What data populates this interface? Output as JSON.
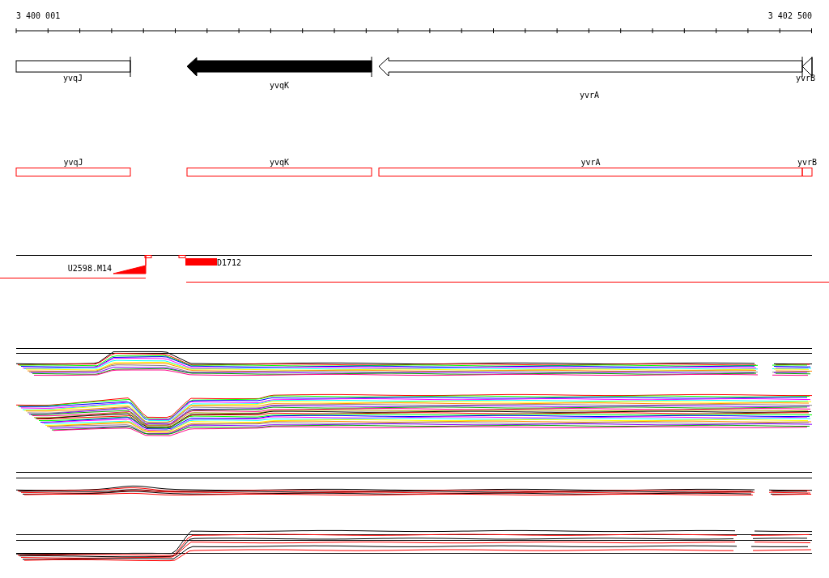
{
  "ruler": {
    "start_label": "3 400 001",
    "end_label": "3 402 500"
  },
  "genes": [
    {
      "name": "yvqJ",
      "kind": "box",
      "filled": false
    },
    {
      "name": "yvqK",
      "kind": "arrow",
      "filled": true
    },
    {
      "name": "yvrA",
      "kind": "arrow",
      "filled": false
    },
    {
      "name": "yvrB",
      "kind": "arrow",
      "filled": false
    }
  ],
  "annotation_track": [
    {
      "name": "yvqJ"
    },
    {
      "name": "yvqK"
    },
    {
      "name": "yvrA"
    },
    {
      "name": "yvrB"
    }
  ],
  "features": [
    {
      "kind": "ramp",
      "label": "U2598.M14"
    },
    {
      "kind": "block",
      "label": "D1712"
    }
  ]
}
